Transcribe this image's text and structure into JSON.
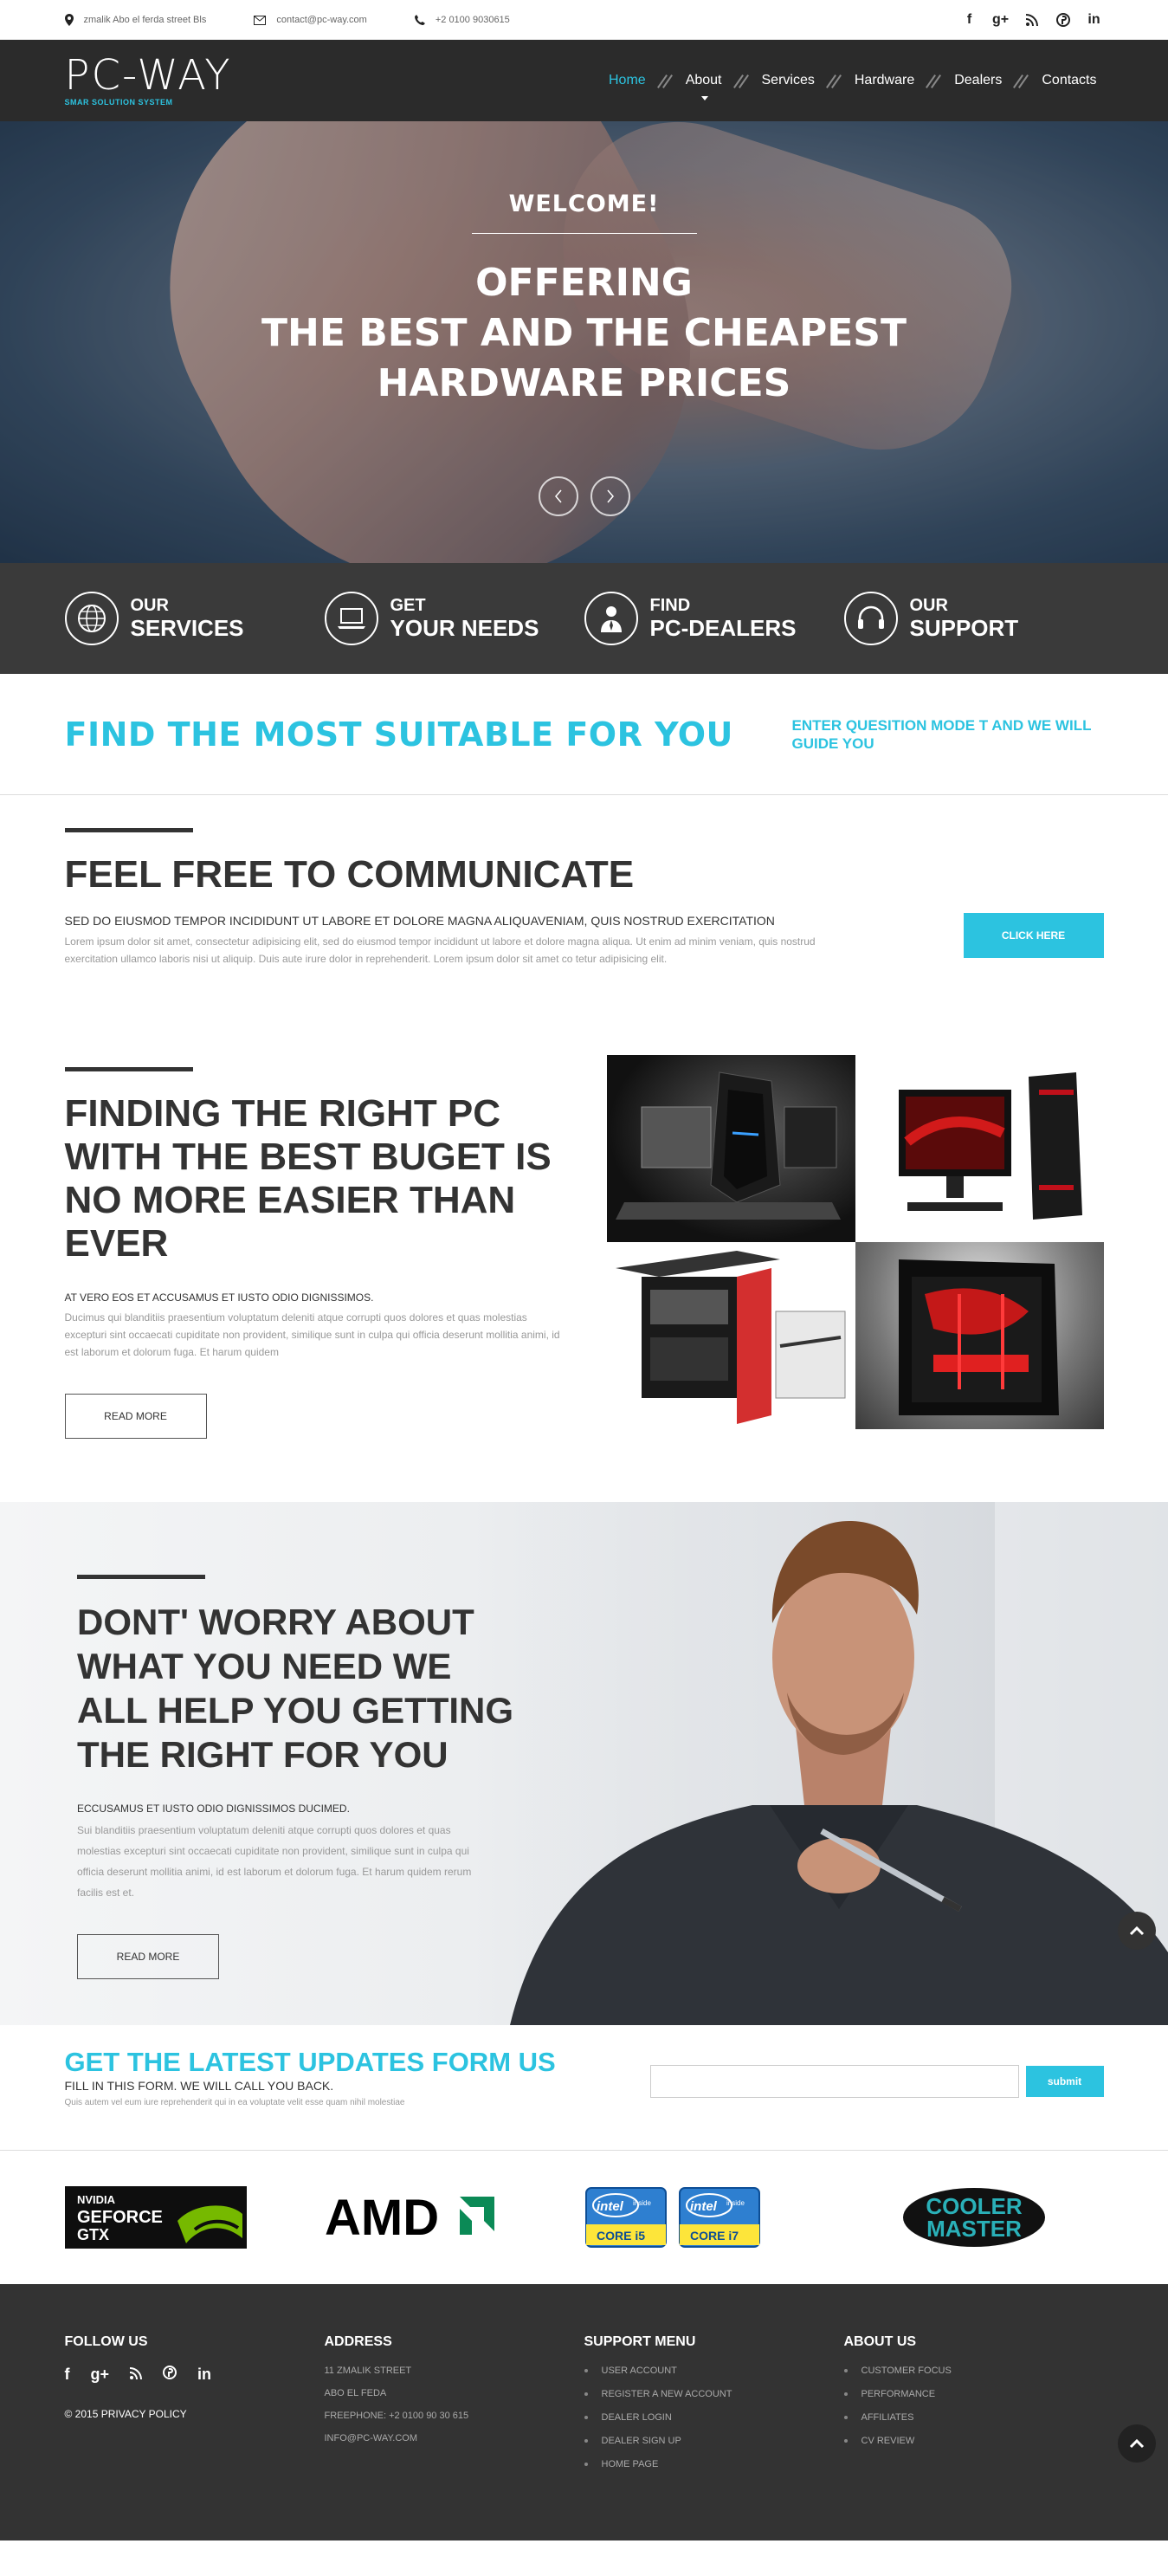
{
  "topbar": {
    "address": "zmalik Abo el ferda street Bls",
    "email": "contact@pc-way.com",
    "phone": "+2 0100 9030615",
    "social": [
      {
        "icon": "facebook-icon",
        "glyph": "f"
      },
      {
        "icon": "google-plus-icon",
        "glyph": "g+"
      },
      {
        "icon": "rss-icon",
        "glyph": "◠"
      },
      {
        "icon": "pinterest-icon",
        "glyph": "℗"
      },
      {
        "icon": "linkedin-icon",
        "glyph": "in"
      }
    ]
  },
  "header": {
    "logo": "PC-WAY",
    "tagline": "SMAR SOLUTION SYSTEM",
    "nav": [
      "Home",
      "About",
      "Services",
      "Hardware",
      "Dealers",
      "Contacts"
    ]
  },
  "hero": {
    "welcome": "WELCOME!",
    "line1": "OFFERING",
    "line2": "THE BEST AND THE CHEAPEST",
    "line3": "HARDWARE PRICES"
  },
  "features": [
    {
      "icon": "globe-icon",
      "top": "OUR",
      "bottom": "SERVICES"
    },
    {
      "icon": "laptop-icon",
      "top": "GET",
      "bottom": "YOUR NEEDS"
    },
    {
      "icon": "user-icon",
      "top": "FIND",
      "bottom": "PC-DEALERS"
    },
    {
      "icon": "headset-icon",
      "top": "OUR",
      "bottom": "SUPPORT"
    }
  ],
  "cta": {
    "title": "FIND THE MOST SUITABLE FOR YOU",
    "side": "ENTER QUESITION MODE T AND WE WILL GUIDE YOU"
  },
  "communicate": {
    "title": "FEEL FREE TO COMMUNICATE",
    "sub": "SED DO EIUSMOD TEMPOR INCIDIDUNT UT LABORE ET DOLORE MAGNA ALIQUAVENIAM, QUIS NOSTRUD EXERCITATION",
    "para": "Lorem ipsum dolor sit amet, consectetur adipisicing elit, sed do eiusmod tempor incididunt ut labore et dolore magna aliqua. Ut enim ad minim veniam, quis nostrud exercitation ullamco laboris nisi ut aliquip. Duis aute irure dolor in reprehenderit. Lorem ipsum dolor sit amet co tetur adipisicing elit.",
    "button": "CLICK HERE"
  },
  "pcs": {
    "title": "FINDING THE RIGHT PC WITH THE BEST BUGET IS NO MORE EASIER THAN EVER",
    "sub": "AT VERO EOS ET ACCUSAMUS ET IUSTO ODIO DIGNISSIMOS.",
    "para": "Ducimus qui blanditiis praesentium voluptatum deleniti atque corrupti quos dolores et quas molestias excepturi sint occaecati cupiditate non provident, similique sunt in culpa qui officia deserunt mollitia animi, id est laborum et dolorum fuga. Et harum quidem",
    "button": "READ MORE"
  },
  "man": {
    "title": "DONT' WORRY ABOUT WHAT YOU NEED WE ALL HELP YOU GETTING THE RIGHT FOR YOU",
    "sub": "ECCUSAMUS ET IUSTO ODIO DIGNISSIMOS DUCIMED.",
    "para": "Sui blanditiis praesentium voluptatum deleniti atque corrupti quos dolores et quas molestias excepturi sint occaecati cupiditate non provident, similique sunt in culpa qui officia deserunt mollitia animi, id est laborum et dolorum fuga. Et harum quidem rerum facilis est et.",
    "button": "READ MORE"
  },
  "newsletter": {
    "title": "GET THE LATEST UPDATES FORM US",
    "sub": "FILL IN THIS FORM. WE WILL CALL YOU BACK.",
    "note": "Quis autem vel eum iure reprehenderit qui in ea voluptate velit esse quam nihil molestiae",
    "button": "submit"
  },
  "brands": {
    "nvidia": [
      "NVIDIA",
      "GEFORCE",
      "GTX"
    ],
    "amd": "AMD",
    "intel_inside": "intel",
    "intel_inside_sub": "inside",
    "intel_i5": "CORE i5",
    "intel_i7": "CORE i7",
    "cooler": "COOLER",
    "master": "MASTER"
  },
  "footer": {
    "follow_title": "FOLLOW US",
    "copyright": "© 2015 PRIVACY POLICY",
    "address_title": "ADDRESS",
    "address": [
      "11 ZMALIK STREET",
      "ABO EL FEDA",
      "FREEPHONE: +2 0100 90 30 615",
      "INFO@PC-WAY.COM"
    ],
    "support_title": "SUPPORT MENU",
    "support": [
      "USER ACCOUNT",
      "REGISTER A NEW ACCOUNT",
      "DEALER LOGIN",
      "DEALER SIGN UP",
      "HOME PAGE"
    ],
    "about_title": "ABOUT US",
    "about": [
      "CUSTOMER FOCUS",
      "PERFORMANCE",
      "AFFILIATES",
      "CV REVIEW"
    ]
  },
  "colors": {
    "accent": "#2cc3e0",
    "dark": "#333333",
    "header": "#2b2b2b"
  }
}
